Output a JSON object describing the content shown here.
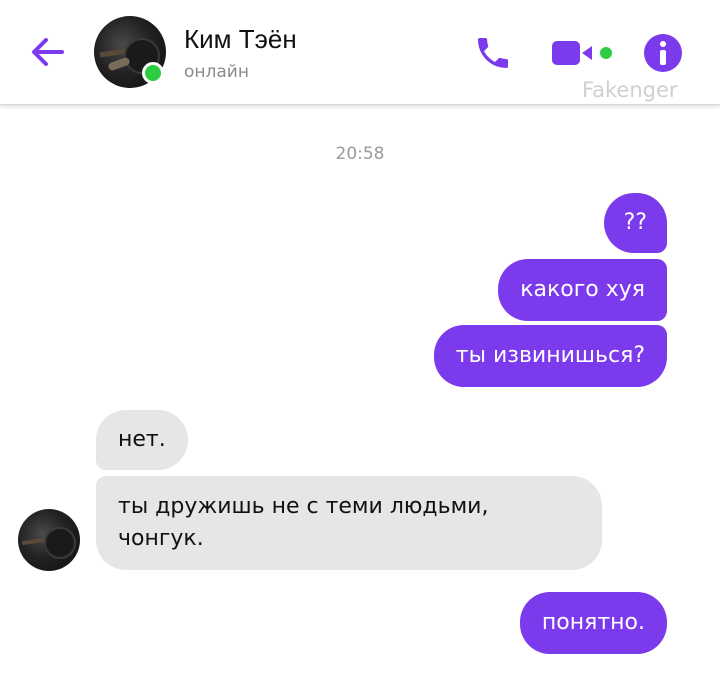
{
  "header": {
    "contact_name": "Ким Тэён",
    "status": "онлайн",
    "watermark": "Fakenger"
  },
  "colors": {
    "accent": "#7c3aed",
    "online": "#2ecc40",
    "incoming_bubble": "#e6e6e6"
  },
  "icons": {
    "back": "arrow-left-icon",
    "call": "phone-icon",
    "video": "video-camera-icon",
    "info": "info-icon"
  },
  "chat": {
    "timestamp": "20:58",
    "messages": [
      {
        "direction": "outgoing",
        "text": "??"
      },
      {
        "direction": "outgoing",
        "text": "какого хуя"
      },
      {
        "direction": "outgoing",
        "text": "ты извинишься?"
      },
      {
        "direction": "incoming",
        "text": "нет."
      },
      {
        "direction": "incoming",
        "text": "ты дружишь не с теми людьми, чонгук."
      },
      {
        "direction": "outgoing",
        "text": "понятно."
      }
    ]
  }
}
